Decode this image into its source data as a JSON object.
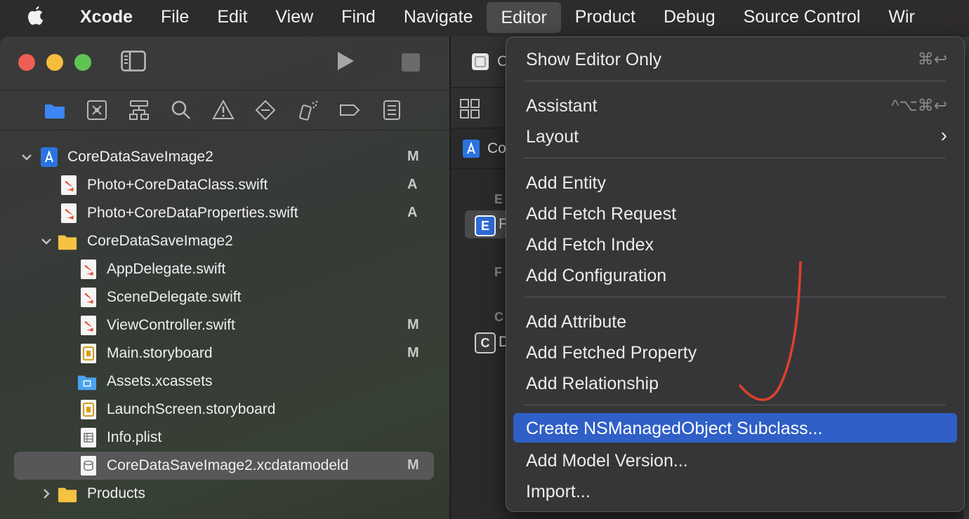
{
  "menubar": {
    "apple_icon": "apple-logo-icon",
    "items": [
      "Xcode",
      "File",
      "Edit",
      "View",
      "Find",
      "Navigate",
      "Editor",
      "Product",
      "Debug",
      "Source Control",
      "Wir"
    ]
  },
  "navigator": {
    "tabs": [
      "folder-icon",
      "source-control-icon",
      "symbol-hierarchy-icon",
      "search-icon",
      "warning-icon",
      "test-diamond-icon",
      "debug-spray-icon",
      "breakpoint-tag-icon",
      "report-list-icon"
    ],
    "tree": [
      {
        "label": "CoreDataSaveImage2",
        "status": "M"
      },
      {
        "label": "Photo+CoreDataClass.swift",
        "status": "A"
      },
      {
        "label": "Photo+CoreDataProperties.swift",
        "status": "A"
      },
      {
        "label": "CoreDataSaveImage2",
        "status": ""
      },
      {
        "label": "AppDelegate.swift",
        "status": ""
      },
      {
        "label": "SceneDelegate.swift",
        "status": ""
      },
      {
        "label": "ViewController.swift",
        "status": "M"
      },
      {
        "label": "Main.storyboard",
        "status": "M"
      },
      {
        "label": "Assets.xcassets",
        "status": ""
      },
      {
        "label": "LaunchScreen.storyboard",
        "status": ""
      },
      {
        "label": "Info.plist",
        "status": ""
      },
      {
        "label": "CoreDataSaveImage2.xcdatamodeld",
        "status": "M"
      },
      {
        "label": "Products",
        "status": ""
      }
    ]
  },
  "editor": {
    "tab_fragment": "C",
    "jump_fragment": "Co",
    "section_e": "E",
    "section_f": "F",
    "section_c": "C",
    "entity_badge": "E",
    "entity_fragment": "F",
    "config_badge": "C",
    "config_fragment": "D"
  },
  "editor_menu": {
    "items": [
      {
        "label": "Show Editor Only",
        "shortcut": "⌘↩"
      },
      {
        "label": "Assistant",
        "shortcut": "^⌥⌘↩"
      },
      {
        "label": "Layout",
        "shortcut": "›"
      },
      {
        "label": "Add Entity",
        "shortcut": ""
      },
      {
        "label": "Add Fetch Request",
        "shortcut": ""
      },
      {
        "label": "Add Fetch Index",
        "shortcut": ""
      },
      {
        "label": "Add Configuration",
        "shortcut": ""
      },
      {
        "label": "Add Attribute",
        "shortcut": ""
      },
      {
        "label": "Add Fetched Property",
        "shortcut": ""
      },
      {
        "label": "Add Relationship",
        "shortcut": ""
      },
      {
        "label": "Create NSManagedObject Subclass...",
        "shortcut": ""
      },
      {
        "label": "Add Model Version...",
        "shortcut": ""
      },
      {
        "label": "Import...",
        "shortcut": ""
      }
    ],
    "highlighted_index": 10,
    "highlight_color": "#2f5fc7"
  },
  "colors": {
    "menubar_bg": "#2e2b2b",
    "swift_icon": "#f05138",
    "folder_icon": "#f5c242",
    "annotation_stroke": "#e0402a"
  }
}
